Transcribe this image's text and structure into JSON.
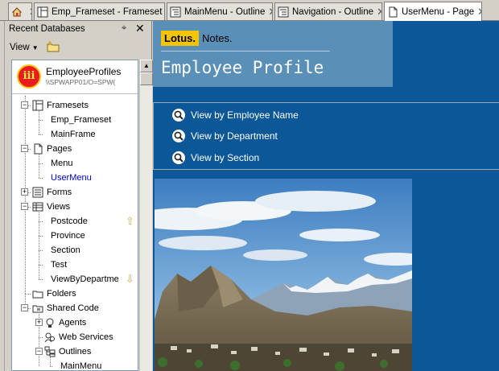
{
  "tabs": [
    {
      "label": "",
      "icon": "home-icon",
      "active": false
    },
    {
      "label": "Emp_Frameset - Frameset",
      "icon": "frameset-icon",
      "active": false
    },
    {
      "label": "MainMenu - Outline",
      "icon": "outline-icon",
      "active": false
    },
    {
      "label": "Navigation - Outline",
      "icon": "outline-icon",
      "active": false
    },
    {
      "label": "UserMenu - Page",
      "icon": "page-icon",
      "active": true
    }
  ],
  "left_panel": {
    "title": "Recent Databases",
    "view_menu": "View",
    "database": {
      "title": "EmployeeProfiles",
      "path": "\\\\SPWAPP01/O=SPW(",
      "logo_text": "iii"
    },
    "tree": [
      {
        "label": "Framesets",
        "level": 0,
        "expander": "minus",
        "icon": "framesets-icon"
      },
      {
        "label": "Emp_Frameset",
        "level": 1,
        "icon": ""
      },
      {
        "label": "MainFrame",
        "level": 1,
        "icon": ""
      },
      {
        "label": "Pages",
        "level": 0,
        "expander": "minus",
        "icon": "pages-icon"
      },
      {
        "label": "Menu",
        "level": 1,
        "icon": ""
      },
      {
        "label": "UserMenu",
        "level": 1,
        "icon": "",
        "selected": true
      },
      {
        "label": "Forms",
        "level": 0,
        "expander": "plus",
        "icon": "forms-icon"
      },
      {
        "label": "Views",
        "level": 0,
        "expander": "minus",
        "icon": "views-icon"
      },
      {
        "label": "Postcode",
        "level": 1,
        "icon": "",
        "scroll": "up"
      },
      {
        "label": "Province",
        "level": 1,
        "icon": ""
      },
      {
        "label": "Section",
        "level": 1,
        "icon": ""
      },
      {
        "label": "Test",
        "level": 1,
        "icon": ""
      },
      {
        "label": "ViewByDepartme",
        "level": 1,
        "icon": "",
        "scroll": "down"
      },
      {
        "label": "Folders",
        "level": 0,
        "icon": "folders-icon"
      },
      {
        "label": "Shared Code",
        "level": 0,
        "expander": "minus",
        "icon": "shared-code-icon"
      },
      {
        "label": "Agents",
        "level": 1,
        "expander": "plus",
        "icon": "agents-icon"
      },
      {
        "label": "Web Services",
        "level": 1,
        "icon": "web-services-icon"
      },
      {
        "label": "Outlines",
        "level": 1,
        "expander": "minus",
        "icon": "outlines-icon"
      },
      {
        "label": "MainMenu",
        "level": 2,
        "icon": ""
      }
    ]
  },
  "main": {
    "logo_lotus": "Lotus.",
    "logo_notes": "Notes.",
    "banner_title": "Employee Profile",
    "menu": [
      {
        "label": "View by Employee Name",
        "icon": "magnifier-icon"
      },
      {
        "label": "View by Department",
        "icon": "magnifier-icon"
      },
      {
        "label": "View by Section",
        "icon": "magnifier-icon"
      }
    ]
  },
  "colors": {
    "main_bg": "#0b5797",
    "banner_bg": "#5a8fb8",
    "lotus_yellow": "#f5c400",
    "link_blue": "#0000c8"
  }
}
